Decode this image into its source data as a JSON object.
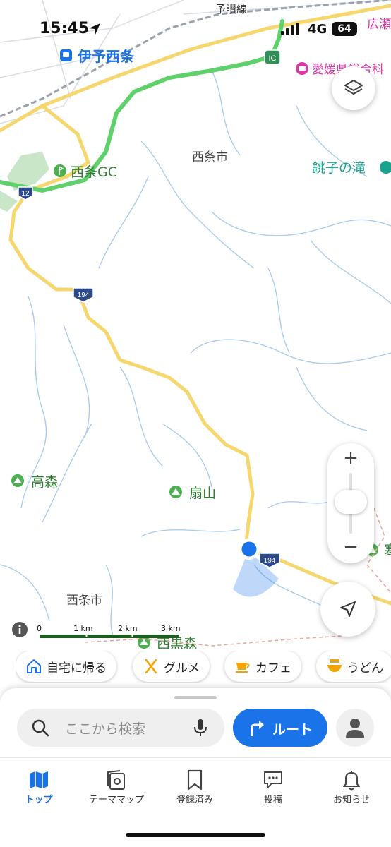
{
  "status": {
    "time": "15:45",
    "network": "4G",
    "battery": "64"
  },
  "map": {
    "places": {
      "station": "伊予西条",
      "golf": "西条GC",
      "city_top": "西条市",
      "waterfall": "銚子の滝",
      "museum": "愛媛県総合科",
      "hirose": "広瀬",
      "yosan": "予讃線",
      "mt_takamori": "高森",
      "mt_ougiyama": "扇山",
      "city_bottom": "西条市",
      "mt_nishikuromori": "西黒森",
      "mt_right_partial": "寒"
    },
    "road_shields": {
      "route_12": "12",
      "route_194_a": "194",
      "route_194_b": "194",
      "ic": "IC"
    },
    "scale": {
      "labels": [
        "0",
        "1 km",
        "2 km",
        "3 km"
      ]
    }
  },
  "zoom": {
    "plus": "+",
    "minus": "−"
  },
  "chips": [
    {
      "icon": "home-icon",
      "label": "自宅に帰る"
    },
    {
      "icon": "utensils-icon",
      "label": "グルメ"
    },
    {
      "icon": "coffee-icon",
      "label": "カフェ"
    },
    {
      "icon": "udon-icon",
      "label": "うどん"
    }
  ],
  "search": {
    "placeholder": "ここから検索"
  },
  "route_button": {
    "label": "ルート"
  },
  "tabs": [
    {
      "icon": "map-icon",
      "label": "トップ",
      "active": true
    },
    {
      "icon": "theme-map-icon",
      "label": "テーママップ",
      "active": false
    },
    {
      "icon": "bookmark-icon",
      "label": "登録済み",
      "active": false
    },
    {
      "icon": "post-icon",
      "label": "投稿",
      "active": false
    },
    {
      "icon": "bell-icon",
      "label": "お知らせ",
      "active": false
    }
  ],
  "colors": {
    "accent": "#1a73e8",
    "expressway": "#5ed16a",
    "national_road": "#f5d76e",
    "river": "#a9c9ea",
    "mountain_label": "#2e7d32",
    "poi_green": "#4caf50",
    "waterfall_label": "#1aa38c",
    "museum_label": "#d33aa5"
  }
}
